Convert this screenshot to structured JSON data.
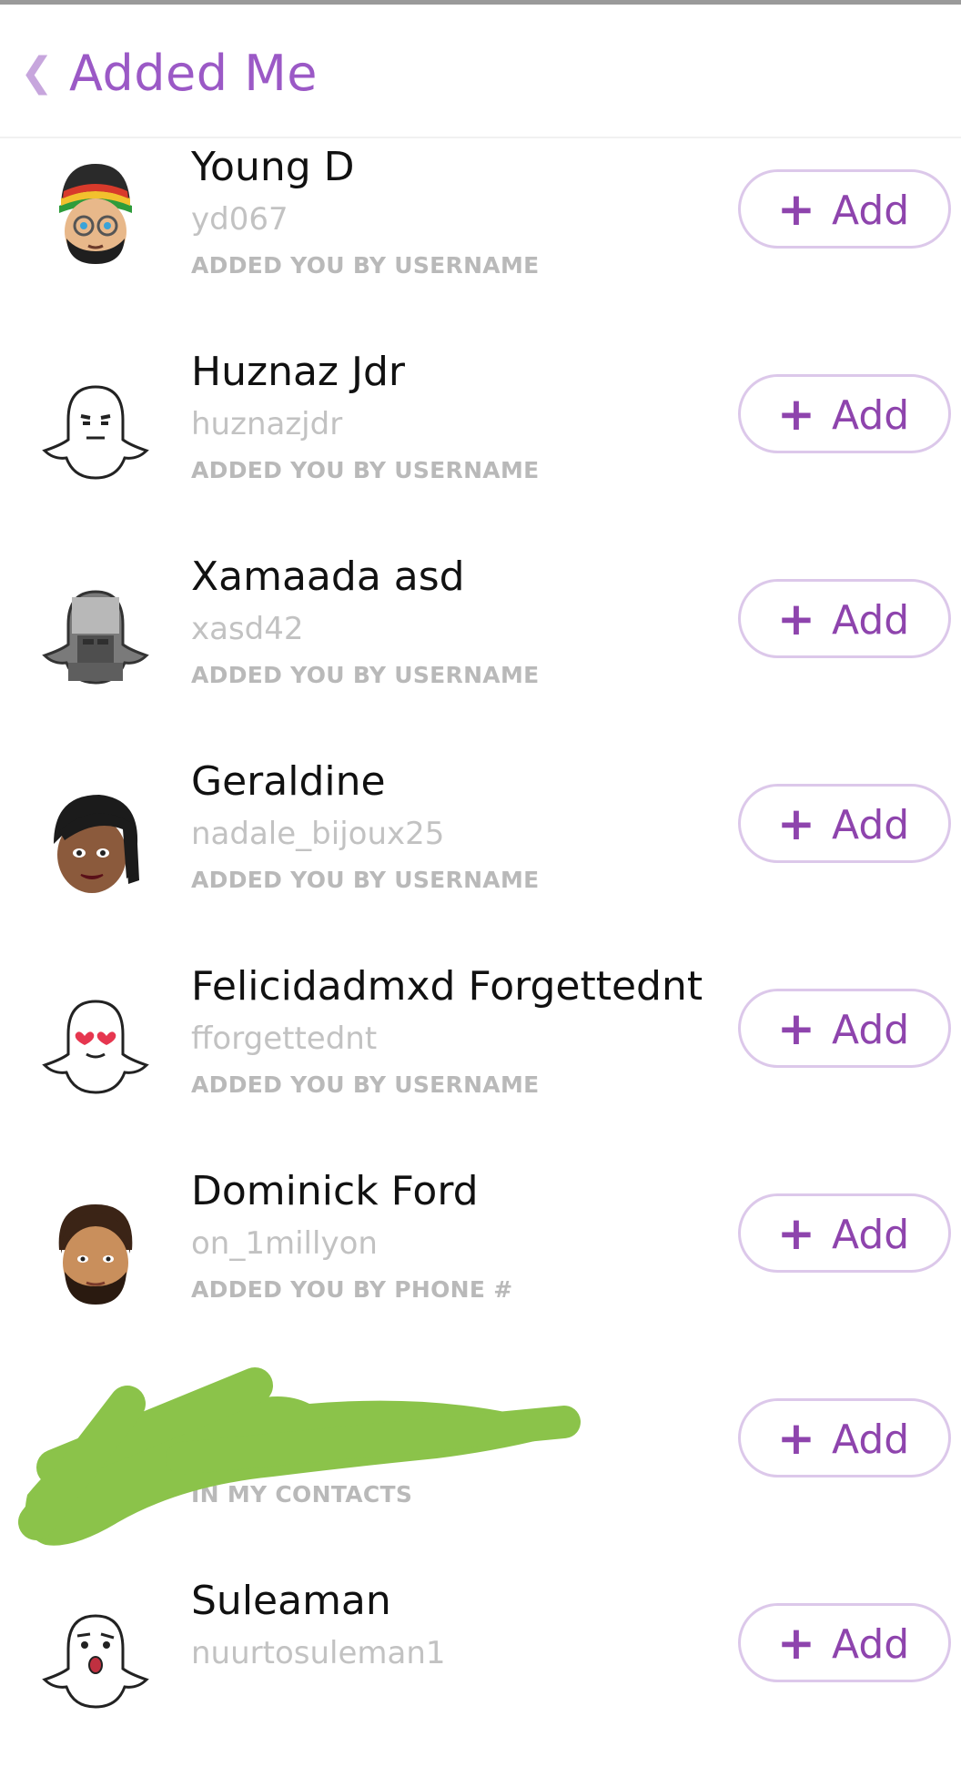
{
  "header": {
    "back_icon": "chevron-left-icon",
    "title": "Added Me"
  },
  "colors": {
    "accent": "#9b59c6",
    "button_border": "#dcc8ea",
    "subtext": "#c2c2c2",
    "reason_text": "#b9b9b9",
    "scribble": "#8bc34a"
  },
  "add_button": {
    "plus": "+",
    "label": "Add"
  },
  "rows": [
    {
      "name": "Young D",
      "username": "yd067",
      "reason": "ADDED YOU BY USERNAME",
      "avatar": "bitmoji-rasta-glasses"
    },
    {
      "name": "Huznaz Jdr",
      "username": "huznazjdr",
      "reason": "ADDED YOU BY USERNAME",
      "avatar": "ghost-serious"
    },
    {
      "name": "Xamaada asd",
      "username": "xasd42",
      "reason": "ADDED YOU BY USERNAME",
      "avatar": "ghost-blurred-photo"
    },
    {
      "name": "Geraldine",
      "username": "nadale_bijoux25",
      "reason": "ADDED YOU BY USERNAME",
      "avatar": "bitmoji-woman"
    },
    {
      "name": "Felicidadmxd Forgettednt",
      "username": "fforgettednt",
      "reason": "ADDED YOU BY USERNAME",
      "avatar": "ghost-heart-eyes"
    },
    {
      "name": "Dominick Ford",
      "username": "on_1millyon",
      "reason": "ADDED YOU BY PHONE #",
      "avatar": "bitmoji-bearded-man"
    },
    {
      "name": "",
      "username": "",
      "reason": "IN MY CONTACTS",
      "avatar": "redacted"
    },
    {
      "name": "Suleaman",
      "username": "nuurtosuleman1",
      "reason": "",
      "avatar": "ghost-surprised"
    }
  ]
}
